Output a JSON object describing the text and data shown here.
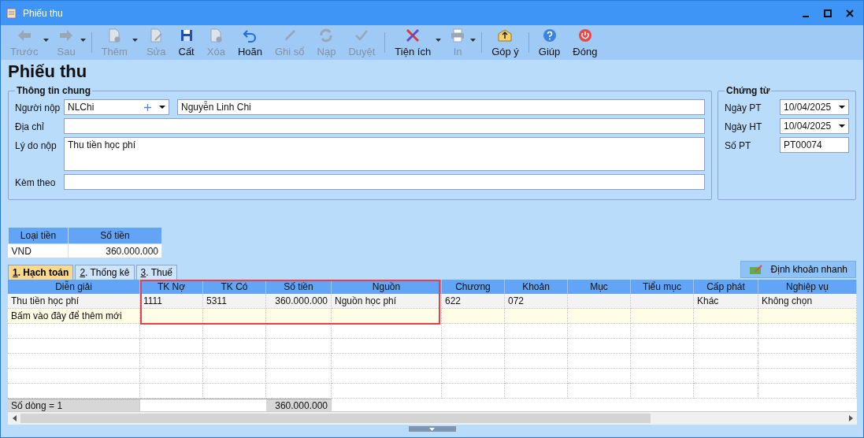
{
  "window": {
    "title": "Phiếu thu"
  },
  "toolbar": [
    {
      "label": "Trước",
      "disabled": true,
      "dropdown": true
    },
    {
      "label": "Sau",
      "disabled": true,
      "dropdown": true
    },
    {
      "label": "Thêm",
      "disabled": true,
      "dropdown": true
    },
    {
      "label": "Sửa",
      "disabled": true,
      "dropdown": false
    },
    {
      "label": "Cất",
      "disabled": false,
      "dropdown": false
    },
    {
      "label": "Xóa",
      "disabled": true,
      "dropdown": false
    },
    {
      "label": "Hoãn",
      "disabled": false,
      "dropdown": false
    },
    {
      "label": "Ghi sổ",
      "disabled": true,
      "dropdown": false
    },
    {
      "label": "Nạp",
      "disabled": true,
      "dropdown": false
    },
    {
      "label": "Duyệt",
      "disabled": true,
      "dropdown": false
    },
    {
      "label": "Tiện ích",
      "disabled": false,
      "dropdown": true
    },
    {
      "label": "In",
      "disabled": true,
      "dropdown": true
    },
    {
      "label": "Góp ý",
      "disabled": false,
      "dropdown": false
    },
    {
      "label": "Giúp",
      "disabled": false,
      "dropdown": false
    },
    {
      "label": "Đóng",
      "disabled": false,
      "dropdown": false
    }
  ],
  "heading": "Phiếu thu",
  "general": {
    "title": "Thông tin chung",
    "fields": [
      {
        "kind": "combo-pair",
        "label": "Người nộp",
        "code": "NLChi",
        "value": "Nguyễn Linh Chi"
      },
      {
        "kind": "text",
        "label": "Địa chỉ"
      },
      {
        "kind": "multiline",
        "label": "Lý do nộp",
        "value": "Thu tiền học phí"
      },
      {
        "kind": "text",
        "label": "Kèm theo"
      }
    ]
  },
  "voucher": {
    "title": "Chứng từ",
    "fields": [
      {
        "kind": "date",
        "label": "Ngày PT",
        "value": "10/04/2025"
      },
      {
        "kind": "date",
        "label": "Ngày HT",
        "value": "10/04/2025"
      },
      {
        "kind": "text",
        "label": "Số PT",
        "value": "PT00074"
      }
    ]
  },
  "currency": {
    "columns": [
      "Loại tiền",
      "Số tiền"
    ],
    "row": [
      "VND",
      "360.000.000"
    ]
  },
  "tabs": [
    {
      "label": "1. Hạch toán",
      "selected": true
    },
    {
      "label": "2. Thống kê",
      "selected": false
    },
    {
      "label": "3. Thuế",
      "selected": false
    }
  ],
  "quick_button": "Định khoản nhanh",
  "grid": {
    "columns": [
      "Diễn giải",
      "TK Nợ",
      "TK Có",
      "Số tiền",
      "Nguồn",
      "Chương",
      "Khoản",
      "Mục",
      "Tiểu mục",
      "Cấp phát",
      "Nghiệp vụ"
    ],
    "rows": [
      [
        "Thu tiền học phí",
        "1111",
        "5311",
        "360.000.000",
        "Nguồn học phí",
        "622",
        "072",
        "",
        "",
        "Khác",
        "Không chọn"
      ]
    ],
    "new_row_hint": "Bấm vào đây để thêm mới",
    "footer": {
      "row_count": "Số dòng = 1",
      "total": "360.000.000"
    }
  }
}
